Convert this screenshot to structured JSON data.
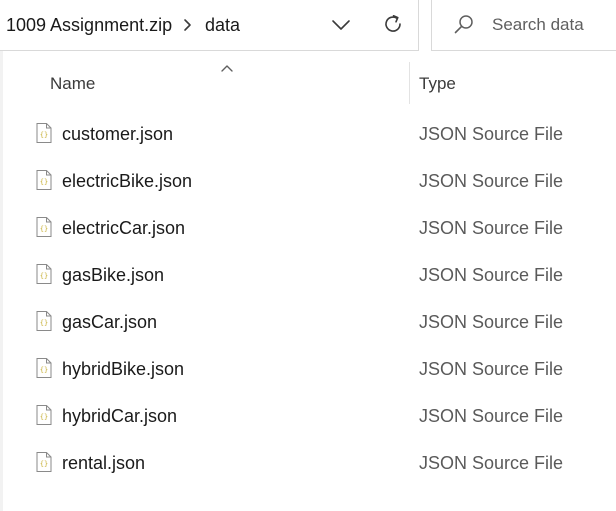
{
  "address_bar": {
    "breadcrumbs": [
      "1009 Assignment.zip",
      "data"
    ],
    "separator_icon": "chevron-right-icon",
    "dropdown_icon": "chevron-down-icon",
    "refresh_icon": "refresh-icon"
  },
  "search": {
    "placeholder": "Search data",
    "value": "",
    "icon": "search-icon"
  },
  "columns": {
    "name": "Name",
    "type": "Type",
    "sort_icon": "chevron-up-icon"
  },
  "files": [
    {
      "name": "customer.json",
      "type": "JSON Source File",
      "icon": "json-file-icon"
    },
    {
      "name": "electricBike.json",
      "type": "JSON Source File",
      "icon": "json-file-icon"
    },
    {
      "name": "electricCar.json",
      "type": "JSON Source File",
      "icon": "json-file-icon"
    },
    {
      "name": "gasBike.json",
      "type": "JSON Source File",
      "icon": "json-file-icon"
    },
    {
      "name": "gasCar.json",
      "type": "JSON Source File",
      "icon": "json-file-icon"
    },
    {
      "name": "hybridBike.json",
      "type": "JSON Source File",
      "icon": "json-file-icon"
    },
    {
      "name": "hybridCar.json",
      "type": "JSON Source File",
      "icon": "json-file-icon"
    },
    {
      "name": "rental.json",
      "type": "JSON Source File",
      "icon": "json-file-icon"
    }
  ],
  "colors": {
    "json_icon_brace": "#c9b23b",
    "icon_stroke": "#5f5f5f",
    "border": "#d9d9d9"
  }
}
